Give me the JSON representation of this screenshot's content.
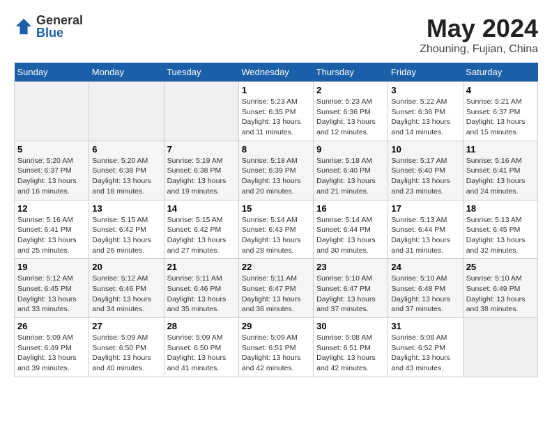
{
  "logo": {
    "general": "General",
    "blue": "Blue"
  },
  "title": {
    "month": "May 2024",
    "location": "Zhouning, Fujian, China"
  },
  "days_of_week": [
    "Sunday",
    "Monday",
    "Tuesday",
    "Wednesday",
    "Thursday",
    "Friday",
    "Saturday"
  ],
  "weeks": [
    [
      {
        "day": "",
        "info": ""
      },
      {
        "day": "",
        "info": ""
      },
      {
        "day": "",
        "info": ""
      },
      {
        "day": "1",
        "info": "Sunrise: 5:23 AM\nSunset: 6:35 PM\nDaylight: 13 hours\nand 11 minutes."
      },
      {
        "day": "2",
        "info": "Sunrise: 5:23 AM\nSunset: 6:36 PM\nDaylight: 13 hours\nand 12 minutes."
      },
      {
        "day": "3",
        "info": "Sunrise: 5:22 AM\nSunset: 6:36 PM\nDaylight: 13 hours\nand 14 minutes."
      },
      {
        "day": "4",
        "info": "Sunrise: 5:21 AM\nSunset: 6:37 PM\nDaylight: 13 hours\nand 15 minutes."
      }
    ],
    [
      {
        "day": "5",
        "info": "Sunrise: 5:20 AM\nSunset: 6:37 PM\nDaylight: 13 hours\nand 16 minutes."
      },
      {
        "day": "6",
        "info": "Sunrise: 5:20 AM\nSunset: 6:38 PM\nDaylight: 13 hours\nand 18 minutes."
      },
      {
        "day": "7",
        "info": "Sunrise: 5:19 AM\nSunset: 6:38 PM\nDaylight: 13 hours\nand 19 minutes."
      },
      {
        "day": "8",
        "info": "Sunrise: 5:18 AM\nSunset: 6:39 PM\nDaylight: 13 hours\nand 20 minutes."
      },
      {
        "day": "9",
        "info": "Sunrise: 5:18 AM\nSunset: 6:40 PM\nDaylight: 13 hours\nand 21 minutes."
      },
      {
        "day": "10",
        "info": "Sunrise: 5:17 AM\nSunset: 6:40 PM\nDaylight: 13 hours\nand 23 minutes."
      },
      {
        "day": "11",
        "info": "Sunrise: 5:16 AM\nSunset: 6:41 PM\nDaylight: 13 hours\nand 24 minutes."
      }
    ],
    [
      {
        "day": "12",
        "info": "Sunrise: 5:16 AM\nSunset: 6:41 PM\nDaylight: 13 hours\nand 25 minutes."
      },
      {
        "day": "13",
        "info": "Sunrise: 5:15 AM\nSunset: 6:42 PM\nDaylight: 13 hours\nand 26 minutes."
      },
      {
        "day": "14",
        "info": "Sunrise: 5:15 AM\nSunset: 6:42 PM\nDaylight: 13 hours\nand 27 minutes."
      },
      {
        "day": "15",
        "info": "Sunrise: 5:14 AM\nSunset: 6:43 PM\nDaylight: 13 hours\nand 28 minutes."
      },
      {
        "day": "16",
        "info": "Sunrise: 5:14 AM\nSunset: 6:44 PM\nDaylight: 13 hours\nand 30 minutes."
      },
      {
        "day": "17",
        "info": "Sunrise: 5:13 AM\nSunset: 6:44 PM\nDaylight: 13 hours\nand 31 minutes."
      },
      {
        "day": "18",
        "info": "Sunrise: 5:13 AM\nSunset: 6:45 PM\nDaylight: 13 hours\nand 32 minutes."
      }
    ],
    [
      {
        "day": "19",
        "info": "Sunrise: 5:12 AM\nSunset: 6:45 PM\nDaylight: 13 hours\nand 33 minutes."
      },
      {
        "day": "20",
        "info": "Sunrise: 5:12 AM\nSunset: 6:46 PM\nDaylight: 13 hours\nand 34 minutes."
      },
      {
        "day": "21",
        "info": "Sunrise: 5:11 AM\nSunset: 6:46 PM\nDaylight: 13 hours\nand 35 minutes."
      },
      {
        "day": "22",
        "info": "Sunrise: 5:11 AM\nSunset: 6:47 PM\nDaylight: 13 hours\nand 36 minutes."
      },
      {
        "day": "23",
        "info": "Sunrise: 5:10 AM\nSunset: 6:47 PM\nDaylight: 13 hours\nand 37 minutes."
      },
      {
        "day": "24",
        "info": "Sunrise: 5:10 AM\nSunset: 6:48 PM\nDaylight: 13 hours\nand 37 minutes."
      },
      {
        "day": "25",
        "info": "Sunrise: 5:10 AM\nSunset: 6:49 PM\nDaylight: 13 hours\nand 38 minutes."
      }
    ],
    [
      {
        "day": "26",
        "info": "Sunrise: 5:09 AM\nSunset: 6:49 PM\nDaylight: 13 hours\nand 39 minutes."
      },
      {
        "day": "27",
        "info": "Sunrise: 5:09 AM\nSunset: 6:50 PM\nDaylight: 13 hours\nand 40 minutes."
      },
      {
        "day": "28",
        "info": "Sunrise: 5:09 AM\nSunset: 6:50 PM\nDaylight: 13 hours\nand 41 minutes."
      },
      {
        "day": "29",
        "info": "Sunrise: 5:09 AM\nSunset: 6:51 PM\nDaylight: 13 hours\nand 42 minutes."
      },
      {
        "day": "30",
        "info": "Sunrise: 5:08 AM\nSunset: 6:51 PM\nDaylight: 13 hours\nand 42 minutes."
      },
      {
        "day": "31",
        "info": "Sunrise: 5:08 AM\nSunset: 6:52 PM\nDaylight: 13 hours\nand 43 minutes."
      },
      {
        "day": "",
        "info": ""
      }
    ]
  ]
}
